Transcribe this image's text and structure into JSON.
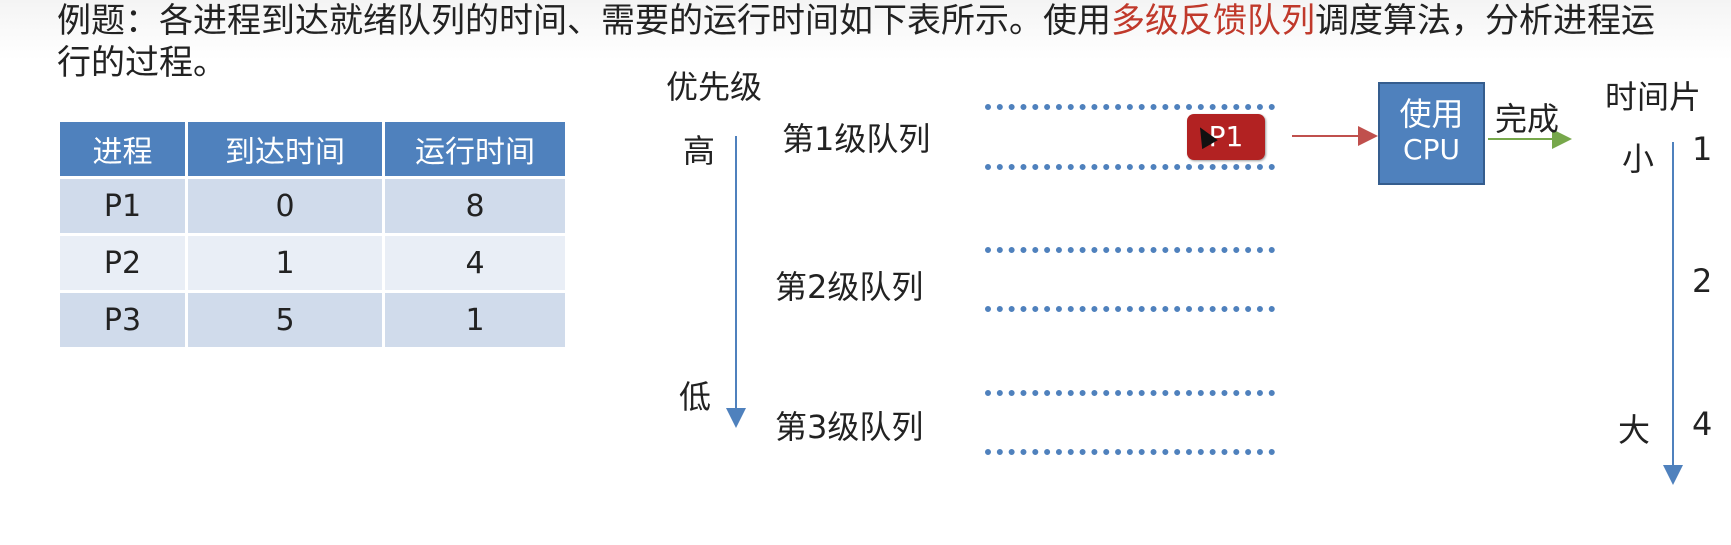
{
  "title": {
    "prefix": "例题：各进程到达就绪队列的时间、需要的运行时间如下表所示。使用",
    "highlight": "多级反馈队列",
    "suffix": "调度算法，分析进程运行的过程。"
  },
  "table": {
    "headers": [
      "进程",
      "到达时间",
      "运行时间"
    ],
    "rows": [
      [
        "P1",
        "0",
        "8"
      ],
      [
        "P2",
        "1",
        "4"
      ],
      [
        "P3",
        "5",
        "1"
      ]
    ]
  },
  "priority": {
    "label": "优先级",
    "high": "高",
    "low": "低"
  },
  "queues": [
    "第1级队列",
    "第2级队列",
    "第3级队列"
  ],
  "process_box": "P1",
  "cpu": {
    "line1": "使用",
    "line2": "CPU"
  },
  "done_label": "完成",
  "timeslice": {
    "label": "时间片",
    "small": "小",
    "large": "大",
    "values": [
      "1",
      "2",
      "4"
    ]
  },
  "colors": {
    "accent_blue": "#4f81bd",
    "highlight_red": "#c0392b",
    "process_red": "#b22222",
    "arrow_brown": "#c0504d",
    "arrow_green": "#77a84b"
  }
}
